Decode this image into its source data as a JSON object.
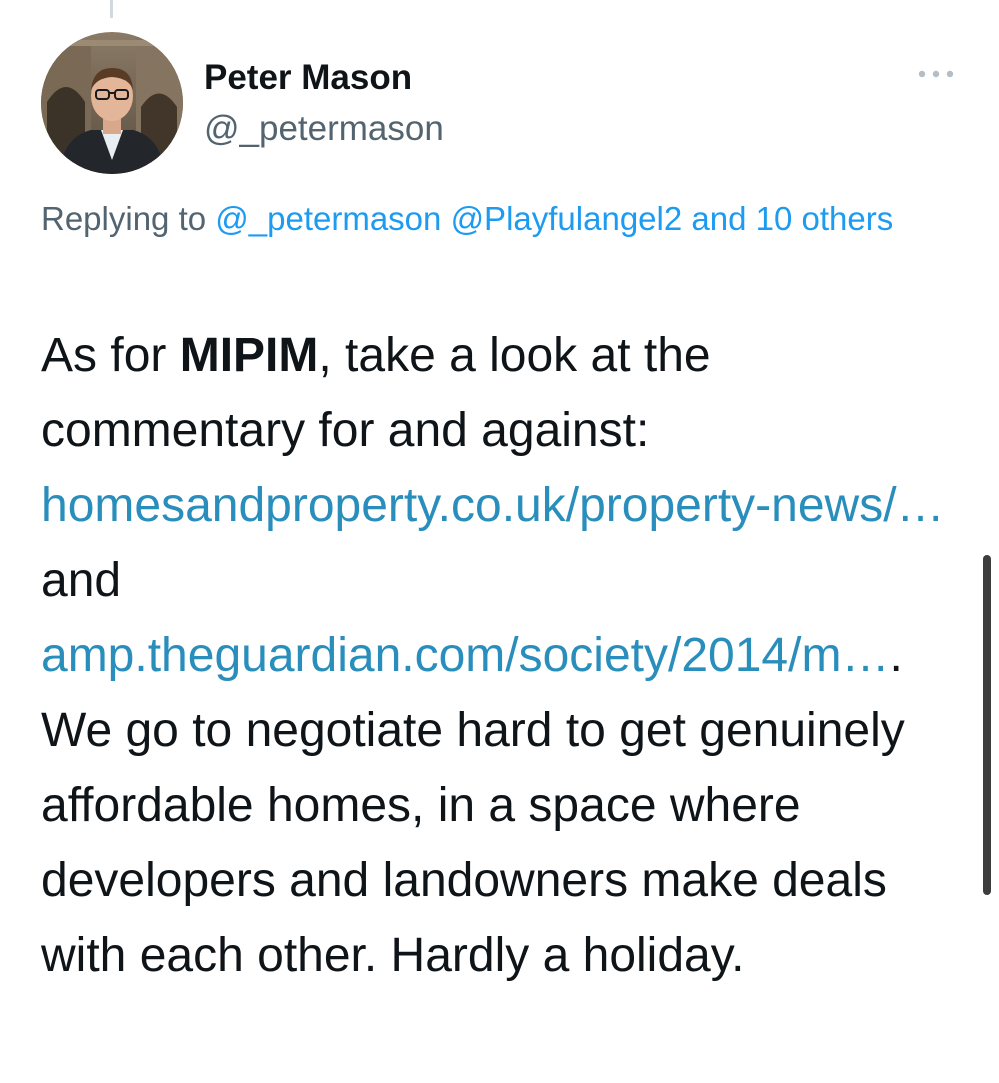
{
  "author": {
    "name": "Peter Mason",
    "handle": "@_petermason"
  },
  "reply_context": {
    "prefix": "Replying to ",
    "mention_1": "@_petermason",
    "mention_2": "@Playfulangel2",
    "others": "and 10 others"
  },
  "tweet": {
    "part_1": "As for ",
    "bold_1": "MIPIM",
    "part_2": ", take a look at the commentary for and against: ",
    "link_1": "homesandproperty.co.uk/property-news/…",
    "part_3": " and ",
    "link_2": "amp.theguardian.com/society/2014/m…",
    "part_4": ". We go to negotiate hard to get genuinely affordable homes, in a space where developers and landowners make deals with each other. Hardly a holiday."
  },
  "icons": {
    "more": "more-options-icon",
    "avatar": "profile-photo"
  },
  "colors": {
    "link": "#2a8ebc",
    "mention": "#1d9bf0",
    "secondary_text": "#536471",
    "primary_text": "#0f1419"
  }
}
